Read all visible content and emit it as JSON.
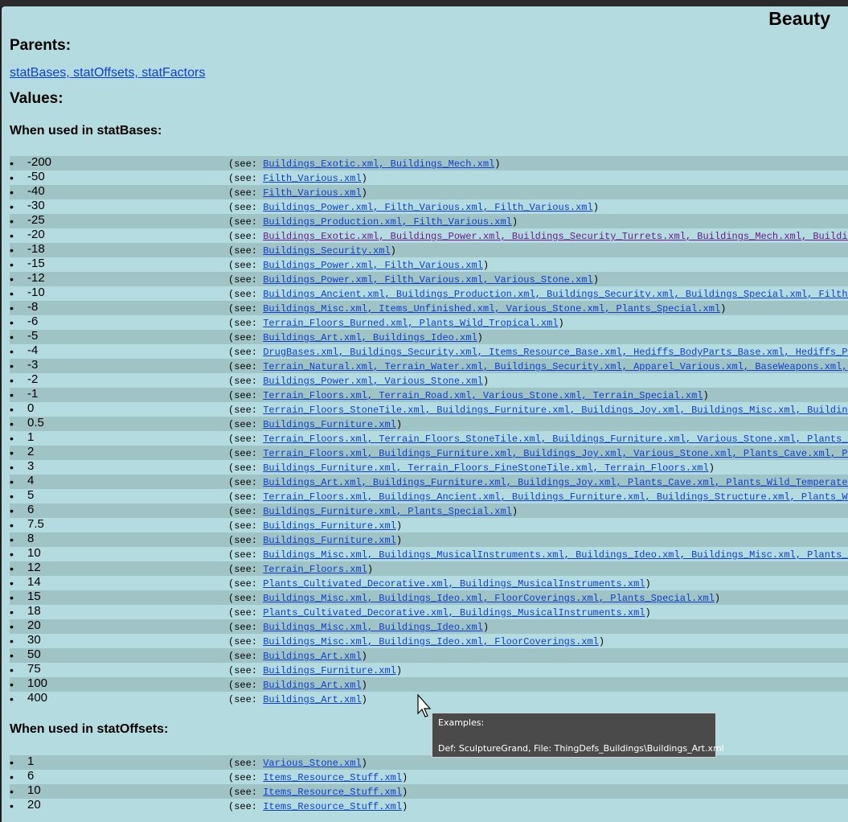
{
  "page": {
    "title": "Beauty"
  },
  "parents": {
    "heading": "Parents:",
    "links_text": "statBases, statOffsets, statFactors"
  },
  "values": {
    "heading": "Values:"
  },
  "statBases": {
    "heading": "When used in statBases:",
    "rows": [
      {
        "value": "-200",
        "files": "Buildings_Exotic.xml, Buildings_Mech.xml"
      },
      {
        "value": "-50",
        "files": "Filth_Various.xml"
      },
      {
        "value": "-40",
        "files": "Filth_Various.xml"
      },
      {
        "value": "-30",
        "files": "Buildings_Power.xml, Filth_Various.xml, Filth_Various.xml"
      },
      {
        "value": "-25",
        "files": "Buildings_Production.xml, Filth_Various.xml"
      },
      {
        "value": "-20",
        "files": "Buildings_Exotic.xml, Buildings_Power.xml, Buildings_Security_Turrets.xml, Buildings_Mech.xml, Buildin"
      },
      {
        "value": "-18",
        "files": "Buildings_Security.xml"
      },
      {
        "value": "-15",
        "files": "Buildings_Power.xml, Filth_Various.xml"
      },
      {
        "value": "-12",
        "files": "Buildings_Power.xml, Filth_Various.xml, Various_Stone.xml"
      },
      {
        "value": "-10",
        "files": "Buildings_Ancient.xml, Buildings_Production.xml, Buildings_Security.xml, Buildings_Special.xml, Filth_"
      },
      {
        "value": "-8",
        "files": "Buildings_Misc.xml, Items_Unfinished.xml, Various_Stone.xml, Plants_Special.xml"
      },
      {
        "value": "-6",
        "files": "Terrain_Floors_Burned.xml, Plants_Wild_Tropical.xml"
      },
      {
        "value": "-5",
        "files": "Buildings_Art.xml, Buildings_Ideo.xml"
      },
      {
        "value": "-4",
        "files": "DrugBases.xml, Buildings_Security.xml, Items_Resource_Base.xml, Hediffs_BodyParts_Base.xml, Hediffs_Ps"
      },
      {
        "value": "-3",
        "files": "Terrain_Natural.xml, Terrain_Water.xml, Buildings_Security.xml, Apparel_Various.xml, BaseWeapons.xml,"
      },
      {
        "value": "-2",
        "files": "Buildings_Power.xml, Various_Stone.xml"
      },
      {
        "value": "-1",
        "files": "Terrain_Floors.xml, Terrain_Road.xml, Various_Stone.xml, Terrain_Special.xml"
      },
      {
        "value": "0",
        "files": "Terrain_Floors_StoneTile.xml, Buildings_Furniture.xml, Buildings_Joy.xml, Buildings_Misc.xml, Building"
      },
      {
        "value": "0.5",
        "files": "Buildings_Furniture.xml"
      },
      {
        "value": "1",
        "files": "Terrain_Floors.xml, Terrain_Floors_StoneTile.xml, Buildings_Furniture.xml, Various_Stone.xml, Plants_C"
      },
      {
        "value": "2",
        "files": "Terrain_Floors.xml, Buildings_Furniture.xml, Buildings_Joy.xml, Various_Stone.xml, Plants_Cave.xml, Pl"
      },
      {
        "value": "3",
        "files": "Buildings_Furniture.xml, Terrain_Floors_FineStoneTile.xml, Terrain_Floors.xml"
      },
      {
        "value": "4",
        "files": "Buildings_Art.xml, Buildings_Furniture.xml, Buildings_Joy.xml, Plants_Cave.xml, Plants_Wild_Temperate."
      },
      {
        "value": "5",
        "files": "Terrain_Floors.xml, Buildings_Ancient.xml, Buildings_Furniture.xml, Buildings_Structure.xml, Plants_Wi"
      },
      {
        "value": "6",
        "files": "Buildings_Furniture.xml, Plants_Special.xml"
      },
      {
        "value": "7.5",
        "files": "Buildings_Furniture.xml"
      },
      {
        "value": "8",
        "files": "Buildings_Furniture.xml"
      },
      {
        "value": "10",
        "files": "Buildings_Misc.xml, Buildings_MusicalInstruments.xml, Buildings_Ideo.xml, Buildings_Misc.xml, Plants_S"
      },
      {
        "value": "12",
        "files": "Terrain_Floors.xml"
      },
      {
        "value": "14",
        "files": "Plants_Cultivated_Decorative.xml, Buildings_MusicalInstruments.xml"
      },
      {
        "value": "15",
        "files": "Buildings_Misc.xml, Buildings_Ideo.xml, FloorCoverings.xml, Plants_Special.xml"
      },
      {
        "value": "18",
        "files": "Plants_Cultivated_Decorative.xml, Buildings_MusicalInstruments.xml"
      },
      {
        "value": "20",
        "files": "Buildings_Misc.xml, Buildings_Ideo.xml"
      },
      {
        "value": "30",
        "files": "Buildings_Misc.xml, Buildings_Ideo.xml, FloorCoverings.xml"
      },
      {
        "value": "50",
        "files": "Buildings_Art.xml"
      },
      {
        "value": "75",
        "files": "Buildings_Furniture.xml"
      },
      {
        "value": "100",
        "files": "Buildings_Art.xml"
      },
      {
        "value": "400",
        "files": "Buildings_Art.xml"
      }
    ]
  },
  "statOffsets": {
    "heading": "When used in statOffsets:",
    "rows": [
      {
        "value": "1",
        "files": "Various_Stone.xml"
      },
      {
        "value": "6",
        "files": "Items_Resource_Stuff.xml"
      },
      {
        "value": "10",
        "files": "Items_Resource_Stuff.xml"
      },
      {
        "value": "20",
        "files": "Items_Resource_Stuff.xml"
      }
    ]
  },
  "labels": {
    "see_open": "(see: ",
    "see_close": ")",
    "bullet": "•"
  },
  "tooltip": {
    "title": "Examples:",
    "body": "Def: SculptureGrand, File: ThingDefs_Buildings\\Buildings_Art.xml"
  },
  "colors": {
    "background": "#b4dce0",
    "row_stripe": "#a0c3c6",
    "link": "#0d3fd1",
    "visited_link": "#6a1a8c"
  },
  "icons": {
    "cursor": "mouse-pointer-icon"
  }
}
